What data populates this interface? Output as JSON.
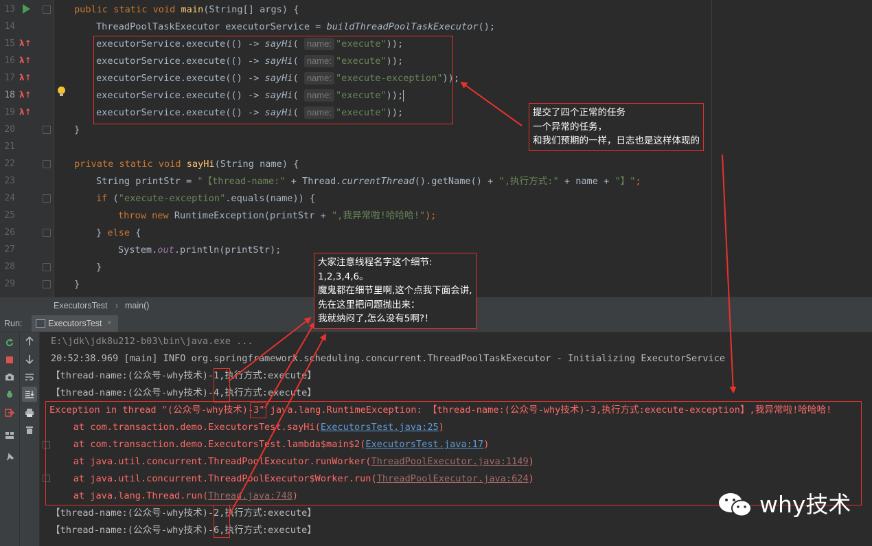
{
  "editor": {
    "line_numbers": [
      "13",
      "14",
      "15",
      "16",
      "17",
      "18",
      "19",
      "20",
      "21",
      "22",
      "23",
      "24",
      "25",
      "26",
      "27",
      "28",
      "29"
    ],
    "lines": {
      "l13": {
        "kw": "public static void ",
        "fn": "main",
        "rest": "(String[] args) {"
      },
      "l14": {
        "a": "ThreadPoolTaskExecutor executorService = ",
        "b": "buildThreadPoolTaskExecutor",
        "c": "();"
      },
      "call_prefix": "executorService.execute(() -> ",
      "call_fn": "sayHi",
      "param_hint": "name:",
      "arg_execute": "\"execute\"",
      "arg_exception": "\"execute-exception\"",
      "call_suffix": ");",
      "l20": "}",
      "l22": {
        "kw": "private static void ",
        "fn": "sayHi",
        "rest": "(String name) {"
      },
      "l23": {
        "a": "String printStr = ",
        "s1": "\"【thread-name:\"",
        "b": " + Thread.",
        "c": "currentThread",
        "d": "().getName() + ",
        "s2": "\",执行方式:\"",
        "e": " + name + ",
        "s3": "\"】\"",
        "f": ";"
      },
      "l24": {
        "a": "if (",
        "s": "\"execute-exception\"",
        "b": ".equals(name)) {"
      },
      "l25": {
        "kw1": "throw new ",
        "a": "RuntimeException(printStr + ",
        "s": "\",我异常啦!哈哈哈!\"",
        "b": ");"
      },
      "l26": {
        "a": "} ",
        "kw": "else",
        "b": " {"
      },
      "l27": {
        "a": "System.",
        "b": "out",
        "c": ".println(printStr);"
      },
      "l28": "}",
      "l29": "}"
    }
  },
  "breadcrumb": {
    "class_name": "ExecutorsTest",
    "separator": "›",
    "method": "main()"
  },
  "run_panel": {
    "label": "Run:",
    "tab_name": "ExecutorsTest",
    "tab_close": "×"
  },
  "console": {
    "cmd": "E:\\jdk\\jdk8u212-b03\\bin\\java.exe ...",
    "init": "20:52:38.969 [main] INFO org.springframework.scheduling.concurrent.ThreadPoolTaskExecutor - Initializing ExecutorService",
    "out1": "【thread-name:(公众号-why技术)-1,执行方式:execute】",
    "out4": "【thread-name:(公众号-why技术)-4,执行方式:execute】",
    "exc": "Exception in thread \"(公众号-why技术)-3\" java.lang.RuntimeException: 【thread-name:(公众号-why技术)-3,执行方式:execute-exception】,我异常啦!哈哈哈!",
    "st1_a": "    at com.transaction.demo.ExecutorsTest.sayHi(",
    "st1_l": "ExecutorsTest.java:25",
    "st1_b": ")",
    "st2_a": "    at com.transaction.demo.ExecutorsTest.lambda$main$2(",
    "st2_l": "ExecutorsTest.java:17",
    "st2_b": ")",
    "st3_a": "    at java.util.concurrent.ThreadPoolExecutor.runWorker(",
    "st3_l": "ThreadPoolExecutor.java:1149",
    "st3_b": ")",
    "st4_a": "    at java.util.concurrent.ThreadPoolExecutor$Worker.run(",
    "st4_l": "ThreadPoolExecutor.java:624",
    "st4_b": ")",
    "st5_a": "    at java.lang.Thread.run(",
    "st5_l": "Thread.java:748",
    "st5_b": ")",
    "out2": "【thread-name:(公众号-why技术)-2,执行方式:execute】",
    "out6": "【thread-name:(公众号-why技术)-6,执行方式:execute】"
  },
  "annotations": {
    "note1": "提交了四个正常的任务\n一个异常的任务，\n和我们预期的一样，日志也是这样体现的",
    "note2": "大家注意线程名字这个细节:\n1,2,3,4,6。\n魔鬼都在细节里啊,这个点我下面会讲,\n先在这里把问题抛出来：\n我就纳闷了,怎么没有5啊?！",
    "annotation_color": "#e8322c"
  },
  "watermark": {
    "text": "why技术",
    "icon": "wechat-icon"
  }
}
